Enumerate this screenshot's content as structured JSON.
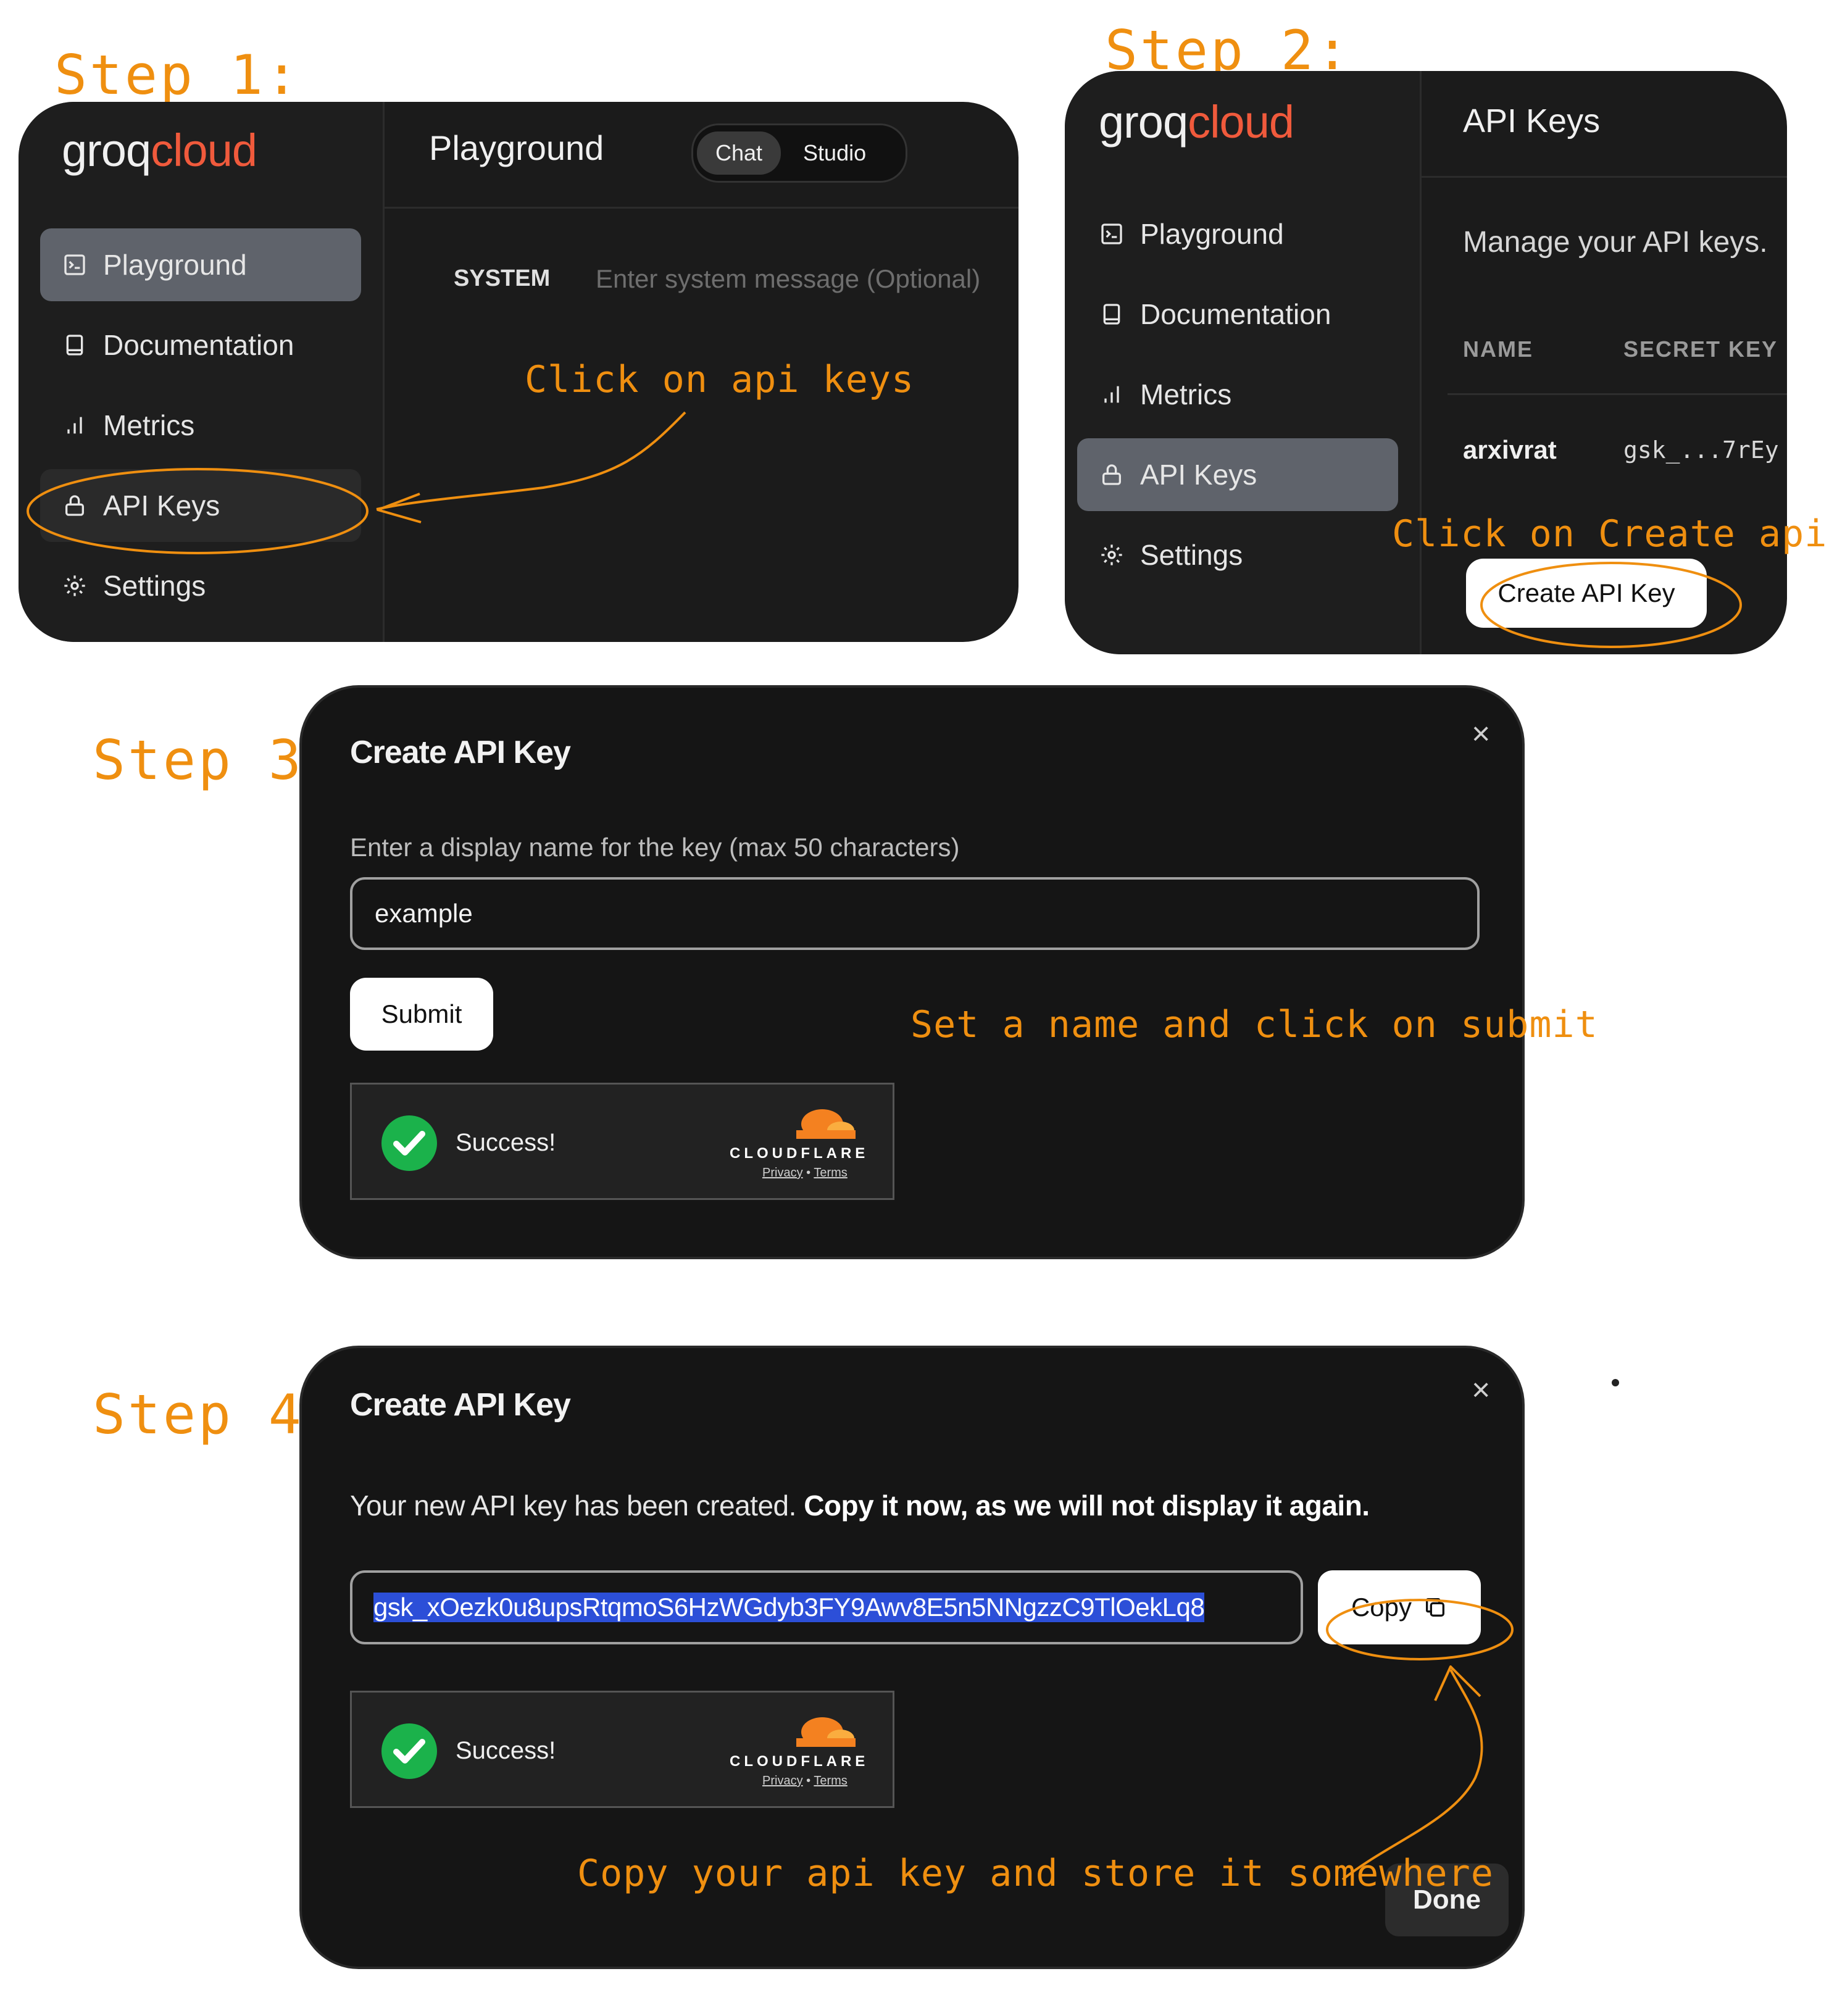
{
  "steps": {
    "s1": "Step 1:",
    "s2": "Step 2:",
    "s3": "Step 3:",
    "s4": "Step 4:"
  },
  "notes": {
    "n1": "Click on api keys",
    "n2": "Click on Create api key",
    "n3": "Set a name and click on submit",
    "n4": "Copy your api key and store it somewhere"
  },
  "logo": {
    "part1": "groq",
    "part2": "cloud"
  },
  "panel1": {
    "title": "Playground",
    "toggle": [
      "Chat",
      "Studio"
    ],
    "system_label": "SYSTEM",
    "system_placeholder": "Enter system message (Optional)",
    "nav": [
      "Playground",
      "Documentation",
      "Metrics",
      "API Keys",
      "Settings"
    ]
  },
  "panel2": {
    "title": "API Keys",
    "subtitle": "Manage your API keys.",
    "columns": [
      "NAME",
      "SECRET KEY"
    ],
    "row": {
      "name": "arxivrat",
      "key": "gsk_...7rEy"
    },
    "create_button": "Create API Key",
    "nav": [
      "Playground",
      "Documentation",
      "Metrics",
      "API Keys",
      "Settings"
    ]
  },
  "modal3": {
    "title": "Create API Key",
    "close": "×",
    "label": "Enter a display name for the key (max 50 characters)",
    "input_value": "example",
    "submit": "Submit",
    "captcha": {
      "success": "Success!",
      "brand": "CLOUDFLARE",
      "privacy": "Privacy",
      "sep": "•",
      "terms": "Terms"
    }
  },
  "modal4": {
    "title": "Create API Key",
    "close": "×",
    "message_plain": "Your new API key has been created. ",
    "message_bold": "Copy it now, as we will not display it again.",
    "api_key": "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",
    "copy": "Copy",
    "done": "Done",
    "captcha": {
      "success": "Success!",
      "brand": "CLOUDFLARE",
      "privacy": "Privacy",
      "sep": "•",
      "terms": "Terms"
    }
  },
  "colors": {
    "accent": "#ef8f10",
    "logo_cloud": "#f05a3c",
    "success": "#1bb24b",
    "panel": "#1b1b1b"
  }
}
